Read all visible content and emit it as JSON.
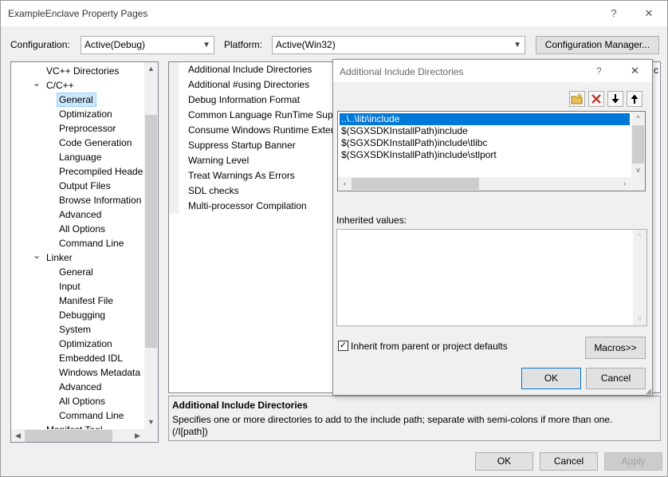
{
  "window": {
    "title": "ExampleEnclave Property Pages",
    "help_glyph": "?",
    "close_glyph": "✕"
  },
  "toolbar": {
    "configuration_label": "Configuration:",
    "configuration_value": "Active(Debug)",
    "platform_label": "Platform:",
    "platform_value": "Active(Win32)",
    "config_manager_label": "Configuration Manager..."
  },
  "tree": {
    "items": [
      {
        "label": "VC++ Directories",
        "level": 1
      },
      {
        "label": "C/C++",
        "level": 1,
        "expander": "⌄"
      },
      {
        "label": "General",
        "level": 2,
        "selected": true
      },
      {
        "label": "Optimization",
        "level": 2
      },
      {
        "label": "Preprocessor",
        "level": 2
      },
      {
        "label": "Code Generation",
        "level": 2
      },
      {
        "label": "Language",
        "level": 2
      },
      {
        "label": "Precompiled Heade",
        "level": 2
      },
      {
        "label": "Output Files",
        "level": 2
      },
      {
        "label": "Browse Information",
        "level": 2
      },
      {
        "label": "Advanced",
        "level": 2
      },
      {
        "label": "All Options",
        "level": 2
      },
      {
        "label": "Command Line",
        "level": 2
      },
      {
        "label": "Linker",
        "level": 1,
        "expander": "⌄"
      },
      {
        "label": "General",
        "level": 2
      },
      {
        "label": "Input",
        "level": 2
      },
      {
        "label": "Manifest File",
        "level": 2
      },
      {
        "label": "Debugging",
        "level": 2
      },
      {
        "label": "System",
        "level": 2
      },
      {
        "label": "Optimization",
        "level": 2
      },
      {
        "label": "Embedded IDL",
        "level": 2
      },
      {
        "label": "Windows Metadata",
        "level": 2
      },
      {
        "label": "Advanced",
        "level": 2
      },
      {
        "label": "All Options",
        "level": 2
      },
      {
        "label": "Command Line",
        "level": 2
      },
      {
        "label": "Manifest Tool",
        "level": 1,
        "expander": "›"
      }
    ]
  },
  "properties": {
    "rows": [
      "Additional Include Directories",
      "Additional #using Directories",
      "Debug Information Format",
      "Common Language RunTime Supp",
      "Consume Windows Runtime Exten",
      "Suppress Startup Banner",
      "Warning Level",
      "Treat Warnings As Errors",
      "SDL checks",
      "Multi-processor Compilation"
    ],
    "value_fragment": "c"
  },
  "description": {
    "title": "Additional Include Directories",
    "text": "Specifies one or more directories to add to the include path; separate with semi-colons if more than one.",
    "switch": "(/I[path])"
  },
  "footer": {
    "ok": "OK",
    "cancel": "Cancel",
    "apply": "Apply"
  },
  "dialog": {
    "title": "Additional Include Directories",
    "help_glyph": "?",
    "close_glyph": "✕",
    "tools": {
      "new_line": "new-folder-icon",
      "delete": "delete-icon",
      "move_down": "arrow-down-icon",
      "move_up": "arrow-up-icon"
    },
    "entries": [
      "..\\..\\lib\\include",
      "$(SGXSDKInstallPath)include",
      "$(SGXSDKInstallPath)include\\tlibc",
      "$(SGXSDKInstallPath)include\\stlport"
    ],
    "inherited_label": "Inherited values:",
    "inherit_checkbox_label": "Inherit from parent or project defaults",
    "inherit_checked": true,
    "macros_label": "Macros>>",
    "ok": "OK",
    "cancel": "Cancel"
  },
  "colors": {
    "accent": "#0078d7",
    "selection_light": "#cce8ff",
    "delete_red": "#c42b1c"
  }
}
